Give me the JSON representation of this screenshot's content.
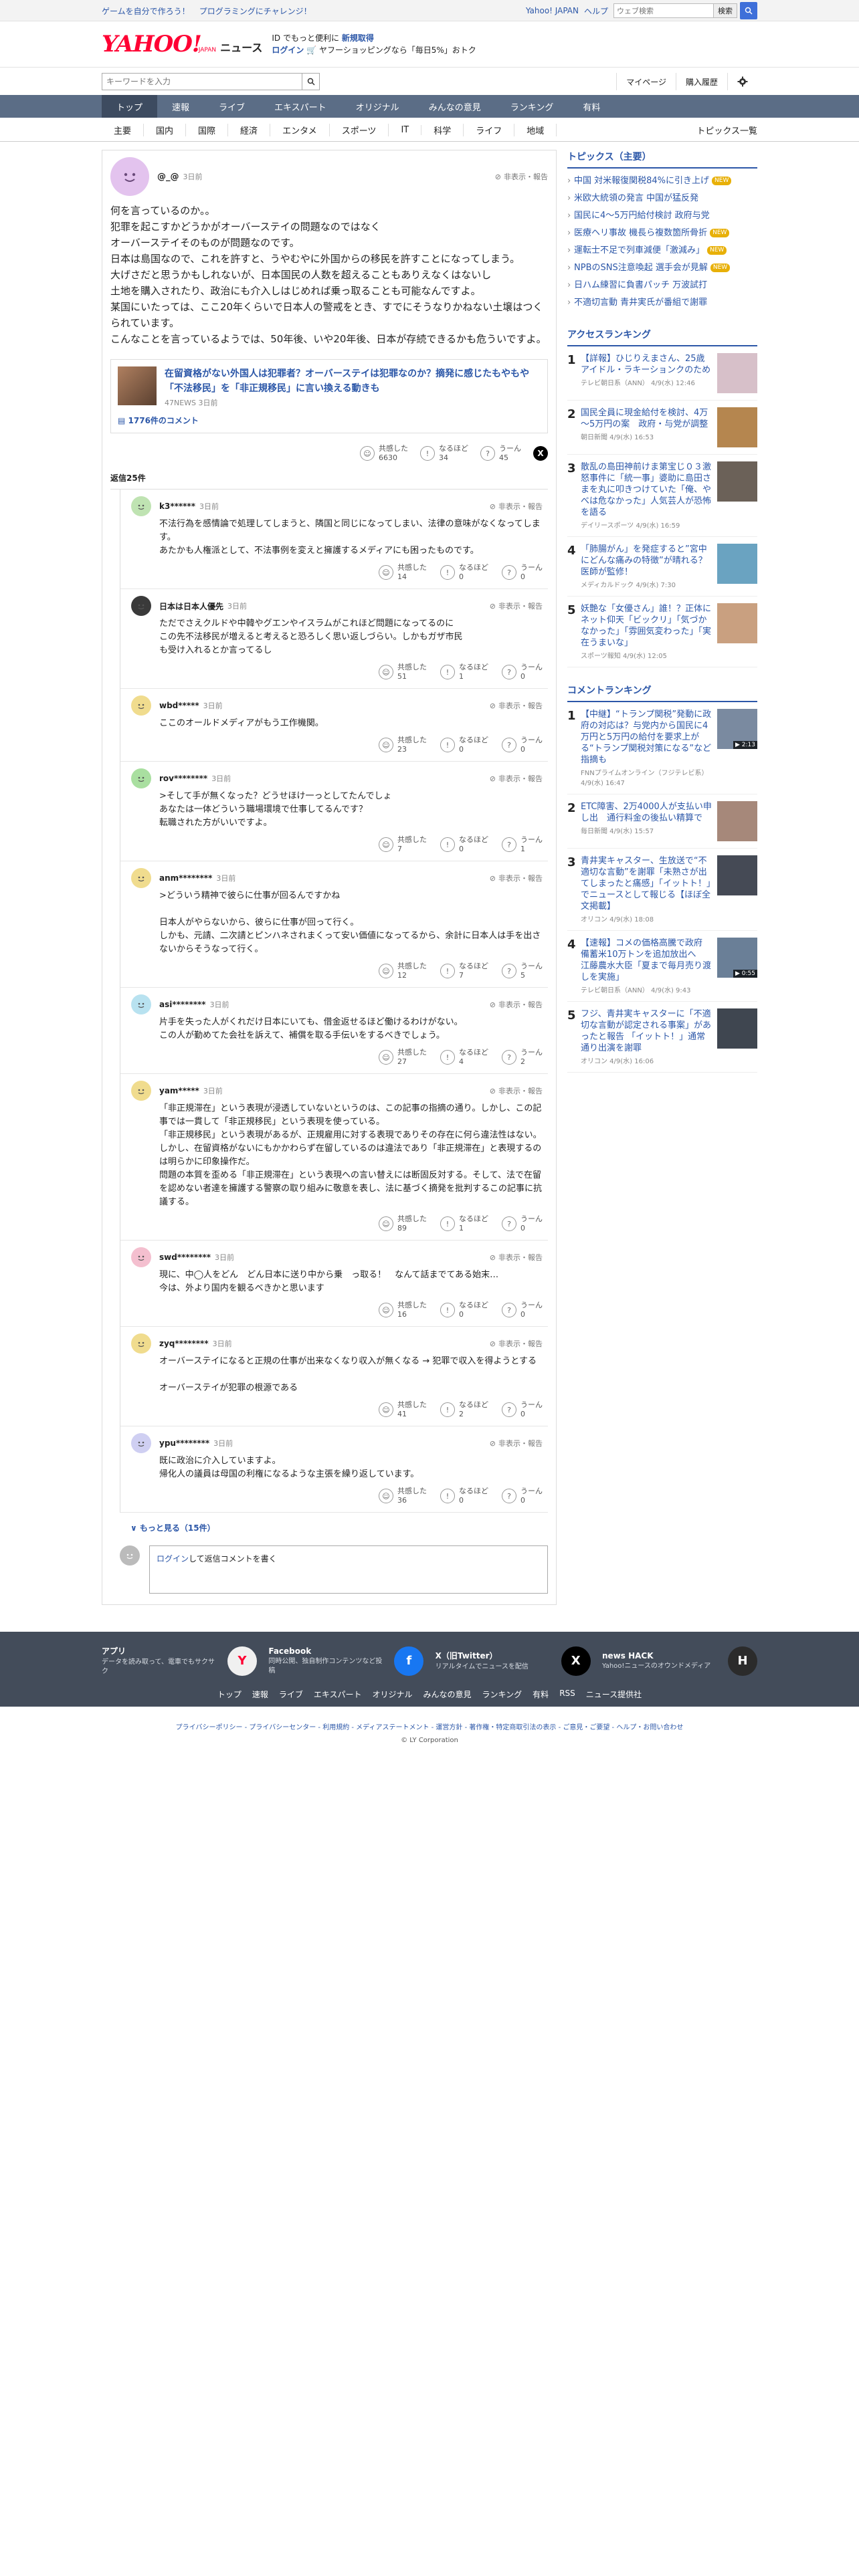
{
  "promo": {
    "link1": "ゲームを自分で作ろう！",
    "link2": "プログラミングにチャレンジ！",
    "yahoo_japan": "Yahoo! JAPAN",
    "help": "ヘルプ",
    "search_placeholder": "ウェブ検索",
    "search_btn": "検索"
  },
  "header": {
    "logo_main": "YAHOO!",
    "logo_sub": "JAPAN",
    "logo_news": "ニュース",
    "msg_line1": "ID でもっと便利に",
    "msg_line1_b": "新規取得",
    "msg_line2_a": "ログイン",
    "msg_line2_b": "ヤフーショッピングなら「毎日5%」おトク"
  },
  "search": {
    "placeholder": "キーワードを入力",
    "mypage": "マイページ",
    "history": "購入履歴"
  },
  "nav": {
    "tabs": [
      "トップ",
      "速報",
      "ライブ",
      "エキスパート",
      "オリジナル",
      "みんなの意見",
      "ランキング",
      "有料"
    ]
  },
  "subnav": {
    "items": [
      "主要",
      "国内",
      "国際",
      "経済",
      "エンタメ",
      "スポーツ",
      "IT",
      "科学",
      "ライフ",
      "地域"
    ],
    "topics_list": "トピックス一覧"
  },
  "main_comment": {
    "user": "@_@",
    "date": "3日前",
    "report": "非表示・報告",
    "body": [
      "何を言っているのか。。",
      "犯罪を起こすかどうかがオーバーステイの問題なのではなく",
      "オーバーステイそのものが問題なのです。",
      "日本は島国なので、これを許すと、うやむやに外国からの移民を許すことになってしまう。",
      "大げさだと思うかもしれないが、日本国民の人数を超えることもありえなくはないし",
      "土地を購入されたり、政治にも介入しはじめれば乗っ取ることも可能なんですよ。",
      "某国にいたっては、ここ20年くらいで日本人の警戒をとき、すでにそうなりかねない土壌はつくられています。",
      "こんなことを言っているようでは、50年後、いや20年後、日本が存続できるかも危ういですよ。"
    ],
    "article": {
      "title": "在留資格がない外国人は犯罪者？オーバーステイは犯罪なのか？摘発に感じたもやもや 「不法移民」を「非正規移民」に言い換える動きも",
      "source": "47NEWS 3日前",
      "comments": "1776件のコメント"
    },
    "reacts": {
      "agree_label": "共感した",
      "agree": "6630",
      "naruhodo_label": "なるほど",
      "naruhodo": "34",
      "uun_label": "うーん",
      "uun": "45"
    }
  },
  "replies_label": "返信25件",
  "replies": [
    {
      "user": "k3******",
      "date": "3日前",
      "avatar": "#bfe3b2",
      "body": [
        "不法行為を感情論で処理してしまうと、隣国と同じになってしまい、法律の意味がなくなってします。",
        "あたかも人権派として、不法事例を変えと擁護するメディアにも困ったものです。"
      ],
      "a": "14",
      "n": "0",
      "u": "0"
    },
    {
      "user": "日本は日本人優先",
      "date": "3日前",
      "avatar": "#3a3a3a",
      "body": [
        "ただでさえクルドや中韓やグエンやイスラムがこれほど問題になってるのに",
        "この先不法移民が増えると考えると恐ろしく思い返しづらい。しかもガザ市民",
        "も受け入れるとか言ってるし"
      ],
      "a": "51",
      "n": "1",
      "u": "0"
    },
    {
      "user": "wbd*****",
      "date": "3日前",
      "avatar": "#f0dc8e",
      "body": [
        "ここのオールドメディアがもう工作機関。"
      ],
      "a": "23",
      "n": "0",
      "u": "0"
    },
    {
      "user": "rov********",
      "date": "3日前",
      "avatar": "#a9dfa0",
      "body": [
        ">そして手が無くなった？どうせほけ一っとしてたんでしょ",
        "あなたは一体どういう職場環境で仕事してるんです？",
        "転職された方がいいですよ。"
      ],
      "a": "7",
      "n": "0",
      "u": "1"
    },
    {
      "user": "anm********",
      "date": "3日前",
      "avatar": "#f0dc8e",
      "body": [
        ">どういう精神で彼らに仕事が回るんですかね",
        "",
        "日本人がやらないから、彼らに仕事が回って行く。",
        "しかも、元請、二次請とピンハネされまくって安い価値になってるから、余計に日本人は手を出さないからそうなって行く。"
      ],
      "a": "12",
      "n": "7",
      "u": "5"
    },
    {
      "user": "asi********",
      "date": "3日前",
      "avatar": "#b8e2f0",
      "body": [
        "片手を失った人がくれだけ日本にいても、借金返せるほど働けるわけがない。",
        "この人が勤めてた会社を訴えて、補償を取る手伝いをするべきでしょう。"
      ],
      "a": "27",
      "n": "4",
      "u": "2"
    },
    {
      "user": "yam*****",
      "date": "3日前",
      "avatar": "#f0dc8e",
      "body": [
        "「非正規滞在」という表現が浸透していないというのは、この記事の指摘の通り。しかし、この記事では一貫して「非正規移民」という表現を使っている。",
        "「非正規移民」という表現があるが、正規雇用に対する表現でありその存在に何ら違法性はない。しかし、在留資格がないにもかかわらず在留しているのは違法であり「非正規滞在」と表現するのは明らかに印象操作だ。",
        "問題の本質を歪める「非正規滞在」という表現への言い替えには断固反対する。そして、法で在留を認めない者達を擁護する警察の取り組みに敬意を表し、法に基づく摘発を批判するこの記事に抗議する。"
      ],
      "a": "89",
      "n": "1",
      "u": "0"
    },
    {
      "user": "swd********",
      "date": "3日前",
      "avatar": "#f4bfcf",
      "body": [
        "現に、中◯人をどん　どん日本に送り中から乗　っ取る！　なんて話までてある始末…",
        "今は、外より国内を観るべきかと思います"
      ],
      "a": "16",
      "n": "0",
      "u": "0"
    },
    {
      "user": "zyq********",
      "date": "3日前",
      "avatar": "#f0dc8e",
      "body": [
        "オーバーステイになると正規の仕事が出来なくなり収入が無くなる → 犯罪で収入を得ようとする",
        "",
        "オーバーステイが犯罪の根源である"
      ],
      "a": "41",
      "n": "2",
      "u": "0"
    },
    {
      "user": "ypu********",
      "date": "3日前",
      "avatar": "#cfcff2",
      "body": [
        "既に政治に介入していますよ。",
        "帰化人の議員は母国の利権になるような主張を繰り返しています。"
      ],
      "a": "36",
      "n": "0",
      "u": "0"
    }
  ],
  "more": "もっと見る（15件）",
  "reply_input": {
    "login": "ログイン",
    "text": "して返信コメントを書く"
  },
  "sidebar": {
    "topics_title": "トピックス（主要）",
    "topics": [
      {
        "t": "中国 対米報復関税84%に引き上げ",
        "new": true
      },
      {
        "t": "米欧大統領の発言 中国が猛反発",
        "new": false
      },
      {
        "t": "国民に4～5万円給付検討 政府与党",
        "new": false
      },
      {
        "t": "医療ヘリ事故 機長ら複数箇所骨折",
        "new": true
      },
      {
        "t": "運転士不足で列車減便「激減み」",
        "new": true
      },
      {
        "t": "NPBのSNS注意喚起 選手会が見解",
        "new": true
      },
      {
        "t": "日ハム練習に負書パッチ 万波試打",
        "new": false
      },
      {
        "t": "不適切言動 青井実氏が番組で謝罪",
        "new": false
      }
    ],
    "new_label": "NEW",
    "access_title": "アクセスランキング",
    "access": [
      {
        "t": "【詳報】ひじりえまさん、25歳 アイドル・ラキーションクのため",
        "src": "テレビ朝日系（ANN） 4/9(水) 12:46",
        "img": "#d7c0c9",
        "vid": ""
      },
      {
        "t": "国民全員に現金給付を検討、4万～5万円の案　政府・与党が調整",
        "src": "朝日新聞 4/9(水) 16:53",
        "img": "#b5864f",
        "vid": ""
      },
      {
        "t": "散乱の島田神前けま第宝じ０３激怒事件に「統一事」婆助に島田さまを丸に叩きつけていた「俺、やべは危なかった」人気芸人が恐怖を語る",
        "src": "デイリースポーツ 4/9(水) 16:59",
        "img": "#6b6158",
        "vid": ""
      },
      {
        "t": "「肺腸がん」を発症すると”宮中にどんな痛みの特徴”が晴れる？医師が監修！",
        "src": "メディカルドック 4/9(水) 7:30",
        "img": "#6aa3c1",
        "vid": ""
      },
      {
        "t": "妖艶な「女優さん」誰！？正体にネット仰天「ビックリ」「気づかなかった」「雰囲気変わった」「実在うまいな」",
        "src": "スポーツ報知 4/9(水) 12:05",
        "img": "#c9a080",
        "vid": ""
      }
    ],
    "comment_title": "コメントランキング",
    "comment": [
      {
        "t": "【中継】“トランプ関税”発動に政府の対応は？与党内から国民に4万円と5万円の給付を要求上がる“トランプ関税対策になる”など指摘も",
        "src": "FNNプライムオンライン（フジテレビ系） 4/9(水) 16:47",
        "img": "#7a8aa0",
        "vid": "▶ 2:13"
      },
      {
        "t": "ETC障害、2万4000人が支払い申し出　通行料金の後払い精算で",
        "src": "毎日新聞 4/9(水) 15:57",
        "img": "#a6887a",
        "vid": ""
      },
      {
        "t": "青井実キャスター、生放送で“不適切な言動”を謝罪「未熟さが出てしまったと痛感」「イットト！」でニュースとして報じる【ほぼ全文掲載】",
        "src": "オリコン 4/9(水) 18:08",
        "img": "#454a55",
        "vid": ""
      },
      {
        "t": "【速報】コメの価格高騰で政府 備蓄米10万トンを追加放出へ　江藤農水大臣「夏まで毎月売り渡しを実施」",
        "src": "テレビ朝日系（ANN） 4/9(水) 9:43",
        "img": "#6a7f97",
        "vid": "▶ 0:55"
      },
      {
        "t": "フジ、青井実キャスターに「不適切な言動が認定される事案」があったと報告 「イットト！」通常通り出演を謝罪",
        "src": "オリコン 4/9(水) 16:06",
        "img": "#3f4650",
        "vid": ""
      }
    ]
  },
  "footer": {
    "apps": [
      {
        "t": "アプリ",
        "d": "データを読み取って、電車でもサクサク",
        "c": "#f0f0f0",
        "g": "Y"
      },
      {
        "t": "Facebook",
        "d": "同時公開、独自制作コンテンツなど投稿",
        "c": "#1877f2",
        "g": "f"
      },
      {
        "t": "X（旧Twitter）",
        "d": "リアルタイムでニュースを配信",
        "c": "#000000",
        "g": "X"
      },
      {
        "t": "news HACK",
        "d": "Yahoo!ニュースのオウンドメディア",
        "c": "#2b2b2b",
        "g": "H"
      }
    ],
    "links": [
      "トップ",
      "速報",
      "ライブ",
      "エキスパート",
      "オリジナル",
      "みんなの意見",
      "ランキング",
      "有料",
      "RSS",
      "ニュース提供社"
    ],
    "links2": "プライバシーポリシー - プライバシーセンター - 利用規約 - メディアステートメント - 運営方針 - 著作権・特定商取引法の表示 - ご意見・ご要望 - ヘルプ・お問い合わせ",
    "copyright": "© LY Corporation"
  },
  "colors": {
    "accent": "#2c57a8",
    "nav": "#5b6d86",
    "nav_active": "#3d4b60",
    "brand": "#ff0033"
  }
}
